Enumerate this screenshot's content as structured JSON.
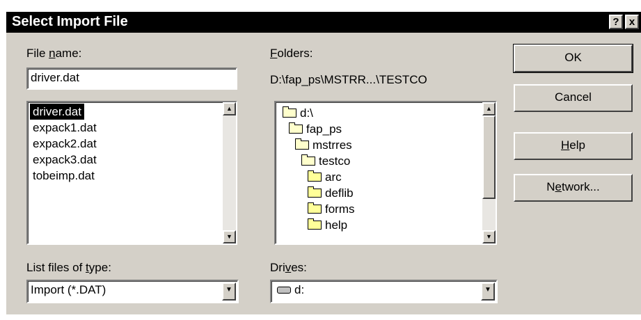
{
  "window": {
    "title": "Select Import File",
    "help_glyph": "?",
    "close_glyph": "x"
  },
  "file_name": {
    "label_pre": "File ",
    "label_access": "n",
    "label_post": "ame:",
    "value": "driver.dat"
  },
  "file_list": {
    "items": [
      "driver.dat",
      "expack1.dat",
      "expack2.dat",
      "expack3.dat",
      "tobeimp.dat"
    ],
    "selected_index": 0
  },
  "folders": {
    "label_access": "F",
    "label_post": "olders:",
    "current_path": "D:\\fap_ps\\MSTRR...\\TESTCO",
    "items": [
      {
        "name": "d:\\",
        "state": "open",
        "indent": 0
      },
      {
        "name": "fap_ps",
        "state": "open",
        "indent": 1
      },
      {
        "name": "mstrres",
        "state": "open",
        "indent": 2
      },
      {
        "name": "testco",
        "state": "open",
        "indent": 3
      },
      {
        "name": "arc",
        "state": "closed",
        "indent": 4
      },
      {
        "name": "deflib",
        "state": "closed",
        "indent": 4
      },
      {
        "name": "forms",
        "state": "closed",
        "indent": 4
      },
      {
        "name": "help",
        "state": "closed",
        "indent": 4
      }
    ]
  },
  "file_type": {
    "label_pre": "List files of ",
    "label_access": "t",
    "label_post": "ype:",
    "value": "Import (*.DAT)"
  },
  "drives": {
    "label_pre": "Dri",
    "label_access": "v",
    "label_post": "es:",
    "value": "d:"
  },
  "buttons": {
    "ok": "OK",
    "cancel": "Cancel",
    "help_access": "H",
    "help_post": "elp",
    "network_pre": "N",
    "network_access": "e",
    "network_post": "twork..."
  },
  "icons": {
    "scroll_up": "▲",
    "scroll_down": "▼",
    "dropdown": "▼",
    "folder_open": "folder-open-icon",
    "folder_closed": "folder-icon",
    "drive": "hard-drive-icon"
  },
  "colors": {
    "face": "#d4d0c8",
    "title_bar": "#000000",
    "selection": "#000000",
    "folder": "#ffff99"
  }
}
